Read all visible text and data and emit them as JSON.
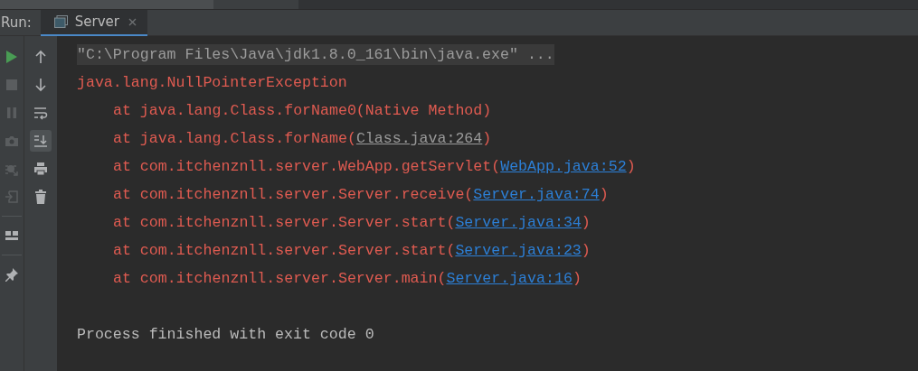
{
  "run_panel": {
    "label": "Run:",
    "tabs": [
      {
        "label": "Server",
        "selected": true,
        "close_icon": true
      }
    ]
  },
  "left_toolbar": [
    {
      "kind": "run",
      "disabled": false
    },
    {
      "kind": "stop",
      "disabled": true
    },
    {
      "kind": "pause",
      "disabled": true
    },
    {
      "kind": "camera",
      "disabled": true
    },
    {
      "kind": "debug",
      "disabled": true
    },
    {
      "kind": "exit",
      "disabled": true
    },
    {
      "kind": "separator"
    },
    {
      "kind": "layout",
      "disabled": false
    },
    {
      "kind": "separator"
    },
    {
      "kind": "pin",
      "disabled": false
    }
  ],
  "right_toolbar": [
    {
      "kind": "up",
      "selected": false
    },
    {
      "kind": "down",
      "selected": false
    },
    {
      "kind": "wrap",
      "selected": false
    },
    {
      "kind": "scroll",
      "selected": true
    },
    {
      "kind": "print",
      "selected": false
    },
    {
      "kind": "trash",
      "selected": false
    }
  ],
  "console": [
    {
      "kind": "command",
      "text": "\"C:\\Program Files\\Java\\jdk1.8.0_161\\bin\\java.exe\" ..."
    },
    {
      "kind": "error",
      "text": "java.lang.NullPointerException"
    },
    {
      "kind": "frame",
      "call": "at java.lang.Class.forName0(Native Method)"
    },
    {
      "kind": "frame",
      "call": "at java.lang.Class.forName(",
      "source": "Class.java:264",
      "dimmed": true,
      "close": ")"
    },
    {
      "kind": "frame",
      "call": "at com.itchenznll.server.WebApp.getServlet(",
      "source": "WebApp.java:52",
      "dimmed": false,
      "close": ")"
    },
    {
      "kind": "frame",
      "call": "at com.itchenznll.server.Server.receive(",
      "source": "Server.java:74",
      "dimmed": false,
      "close": ")"
    },
    {
      "kind": "frame",
      "call": "at com.itchenznll.server.Server.start(",
      "source": "Server.java:34",
      "dimmed": false,
      "close": ")"
    },
    {
      "kind": "frame",
      "call": "at com.itchenznll.server.Server.start(",
      "source": "Server.java:23",
      "dimmed": false,
      "close": ")"
    },
    {
      "kind": "frame",
      "call": "at com.itchenznll.server.Server.main(",
      "source": "Server.java:16",
      "dimmed": false,
      "close": ")"
    },
    {
      "kind": "blank"
    },
    {
      "kind": "info",
      "text": "Process finished with exit code 0"
    }
  ]
}
